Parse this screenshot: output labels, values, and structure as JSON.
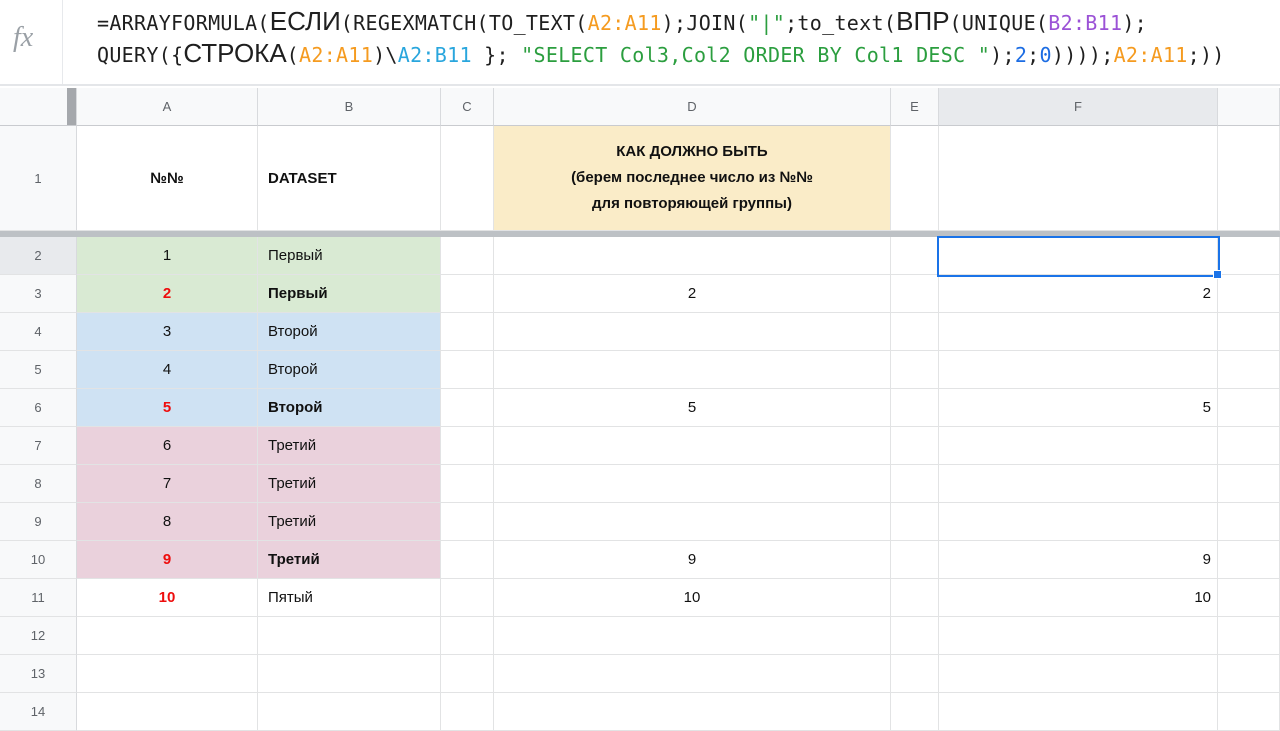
{
  "formula_bar": {
    "fx_label": "fx",
    "colors": {
      "default": "#1f1f1f",
      "orange": "#f59b20",
      "purple": "#9b52d6",
      "cyan": "#29a6dd",
      "green": "#2b9e3f",
      "blue": "#1b6ce3"
    },
    "lines": [
      [
        {
          "t": "=ARRAYFORMULA(",
          "c": "default"
        },
        {
          "t": "ЕСЛИ",
          "c": "default",
          "big": true
        },
        {
          "t": "(REGEXMATCH(TO_TEXT(",
          "c": "default"
        },
        {
          "t": "A2:A11",
          "c": "orange"
        },
        {
          "t": ");JOIN(",
          "c": "default"
        },
        {
          "t": "\"|\"",
          "c": "green"
        },
        {
          "t": ";to_text(",
          "c": "default"
        },
        {
          "t": "ВПР",
          "c": "default",
          "big": true
        },
        {
          "t": "(UNIQUE(",
          "c": "default"
        },
        {
          "t": "B2:B11",
          "c": "purple"
        },
        {
          "t": ");",
          "c": "default"
        }
      ],
      [
        {
          "t": "QUERY({",
          "c": "default"
        },
        {
          "t": "СТРОКА",
          "c": "default",
          "big": true
        },
        {
          "t": "(",
          "c": "default"
        },
        {
          "t": "A2:A11",
          "c": "orange"
        },
        {
          "t": ")\\",
          "c": "default"
        },
        {
          "t": "A2:B11",
          "c": "cyan"
        },
        {
          "t": " }; ",
          "c": "default"
        },
        {
          "t": "\"SELECT Col3,Col2 ORDER BY Col1 DESC \"",
          "c": "green"
        },
        {
          "t": ");",
          "c": "default"
        },
        {
          "t": "2",
          "c": "blue"
        },
        {
          "t": ";",
          "c": "default"
        },
        {
          "t": "0",
          "c": "blue"
        },
        {
          "t": "))));",
          "c": "default"
        },
        {
          "t": "A2:A11",
          "c": "orange"
        },
        {
          "t": ";))",
          "c": "default"
        }
      ]
    ]
  },
  "fills": {
    "green": "#d9ead3",
    "blue": "#cfe2f3",
    "pink": "#ead1dc",
    "yellow": "#faecc8"
  },
  "grid": {
    "column_headers": [
      "A",
      "B",
      "C",
      "D",
      "E",
      "F",
      ""
    ],
    "highlighted_column": "F",
    "highlighted_row": "2",
    "selected_cell": "F2",
    "rows": [
      {
        "n": "1",
        "h": 105,
        "cells": {
          "a": {
            "v": "№№",
            "bold": true
          },
          "b": {
            "v": "DATASET",
            "bold": true
          },
          "d": {
            "v": "КАК ДОЛЖНО БЫТЬ\n(берем последнее число из №№\nдля повторяющей группы)",
            "bold": true,
            "fill": "yellow",
            "multiline": true
          }
        }
      },
      {
        "n": "2",
        "hl": true,
        "cells": {
          "a": {
            "v": "1",
            "fill": "green"
          },
          "b": {
            "v": "Первый",
            "fill": "green"
          }
        }
      },
      {
        "n": "3",
        "cells": {
          "a": {
            "v": "2",
            "red": true,
            "fill": "green"
          },
          "b": {
            "v": "Первый",
            "bold": true,
            "fill": "green"
          },
          "d": {
            "v": "2"
          },
          "f": {
            "v": "2"
          }
        }
      },
      {
        "n": "4",
        "cells": {
          "a": {
            "v": "3",
            "fill": "blue"
          },
          "b": {
            "v": "Второй",
            "fill": "blue"
          }
        }
      },
      {
        "n": "5",
        "cells": {
          "a": {
            "v": "4",
            "fill": "blue"
          },
          "b": {
            "v": "Второй",
            "fill": "blue"
          }
        }
      },
      {
        "n": "6",
        "cells": {
          "a": {
            "v": "5",
            "red": true,
            "fill": "blue"
          },
          "b": {
            "v": "Второй",
            "bold": true,
            "fill": "blue"
          },
          "d": {
            "v": "5"
          },
          "f": {
            "v": "5"
          }
        }
      },
      {
        "n": "7",
        "cells": {
          "a": {
            "v": "6",
            "fill": "pink"
          },
          "b": {
            "v": "Третий",
            "fill": "pink"
          }
        }
      },
      {
        "n": "8",
        "cells": {
          "a": {
            "v": "7",
            "fill": "pink"
          },
          "b": {
            "v": "Третий",
            "fill": "pink"
          }
        }
      },
      {
        "n": "9",
        "cells": {
          "a": {
            "v": "8",
            "fill": "pink"
          },
          "b": {
            "v": "Третий",
            "fill": "pink"
          }
        }
      },
      {
        "n": "10",
        "cells": {
          "a": {
            "v": "9",
            "red": true,
            "fill": "pink"
          },
          "b": {
            "v": "Третий",
            "bold": true,
            "fill": "pink"
          },
          "d": {
            "v": "9"
          },
          "f": {
            "v": "9"
          }
        }
      },
      {
        "n": "11",
        "cells": {
          "a": {
            "v": "10",
            "red": true
          },
          "b": {
            "v": "Пятый"
          },
          "d": {
            "v": "10"
          },
          "f": {
            "v": "10"
          }
        }
      },
      {
        "n": "12",
        "cells": {}
      },
      {
        "n": "13",
        "cells": {}
      },
      {
        "n": "14",
        "cells": {}
      }
    ]
  }
}
